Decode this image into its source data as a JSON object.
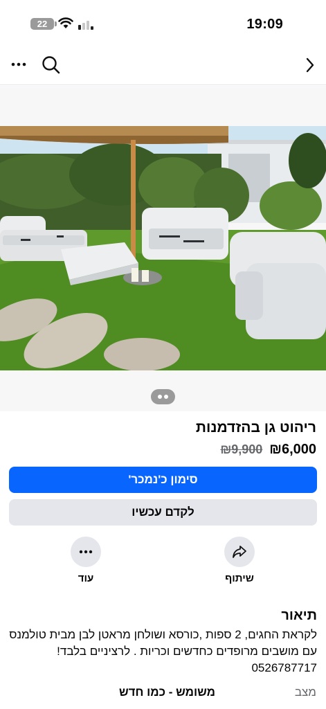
{
  "status_bar": {
    "time": "19:09",
    "battery": "22"
  },
  "nav": {
    "icons": [
      "more-icon",
      "search-icon",
      "chevron-right-icon"
    ]
  },
  "listing": {
    "title": "ריהוט גן בהזדמנות",
    "price_current": "₪6,000",
    "price_old": "₪9,900",
    "primary_button": "סימון כ'נמכר'",
    "secondary_button": "לקדם עכשיו",
    "actions": {
      "more_label": "עוד",
      "share_label": "שיתוף"
    },
    "description_heading": "תיאור",
    "description_text": "לקראת החגים, 2 ספות ,כורסא ושולחן מראטן לבן מבית טולמנס עם מושבים מרופדים כחדשים וכריות . לרציניים בלבד! 0526787717",
    "condition_label": "מצב",
    "condition_value": "משומש - כמו חדש"
  },
  "colors": {
    "accent": "#0866ff",
    "secondary_bg": "#e4e6eb",
    "muted_text": "#65676b"
  }
}
